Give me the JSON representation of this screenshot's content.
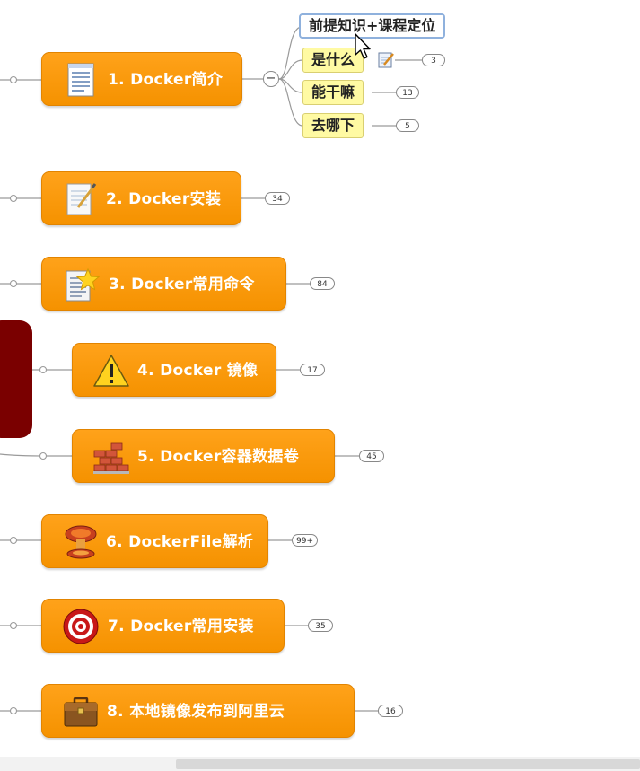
{
  "topics": [
    {
      "label": "1. Docker简介",
      "icon": "document-icon"
    },
    {
      "label": "2. Docker安装",
      "icon": "notepad-pen-icon",
      "count": "34"
    },
    {
      "label": "3. Docker常用命令",
      "icon": "star-document-icon",
      "count": "84"
    },
    {
      "label": "4. Docker 镜像",
      "icon": "warning-icon",
      "count": "17"
    },
    {
      "label": "5. Docker容器数据卷",
      "icon": "bricks-icon",
      "count": "45"
    },
    {
      "label": "6. DockerFile解析",
      "icon": "mushroom-cloud-icon",
      "count": "99+"
    },
    {
      "label": "7. Docker常用安装",
      "icon": "target-icon",
      "count": "35"
    },
    {
      "label": "8. 本地镜像发布到阿里云",
      "icon": "briefcase-icon",
      "count": "16"
    }
  ],
  "subtopics": [
    {
      "label": "前提知识+课程定位"
    },
    {
      "label": "是什么",
      "count": "3"
    },
    {
      "label": "能干嘛",
      "count": "13"
    },
    {
      "label": "去哪下",
      "count": "5"
    }
  ],
  "collapse_symbol": "−",
  "colors": {
    "topic": "#f59200",
    "subtopic": "#fffaa3",
    "panel": "#7a0000"
  }
}
